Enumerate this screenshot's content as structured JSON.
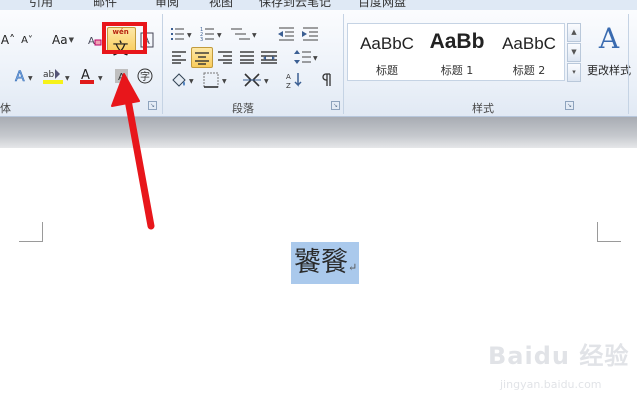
{
  "tabs": [
    {
      "label": "引用"
    },
    {
      "label": "邮件"
    },
    {
      "label": "审阅"
    },
    {
      "label": "视图"
    },
    {
      "label": "保存到云笔记"
    },
    {
      "label": "百度网盘"
    }
  ],
  "font_group": {
    "font_size_buttons": [
      "A˄",
      "A˅"
    ],
    "change_case": "Aa",
    "phonetic_guide": {
      "ruby": "wén",
      "char": "文"
    },
    "label": "体"
  },
  "paragraph_group": {
    "label": "段落"
  },
  "styles_group": {
    "label": "样式",
    "styles": [
      {
        "sample": "AaBbC",
        "name": "标题"
      },
      {
        "sample": "AaBb",
        "name": "标题 1"
      },
      {
        "sample": "AaBbC",
        "name": "标题 2"
      }
    ],
    "change_styles": {
      "glyph": "A",
      "label": "更改样式"
    }
  },
  "document": {
    "selected_text": "饕餮",
    "paragraph_mark": "↵"
  },
  "watermark": {
    "logo": "Baidu 经验",
    "site": "jingyan.baidu.com"
  },
  "colors": {
    "highlight_box": "#e8161b",
    "arrow": "#e8161b",
    "selection": "#aac9ec"
  }
}
